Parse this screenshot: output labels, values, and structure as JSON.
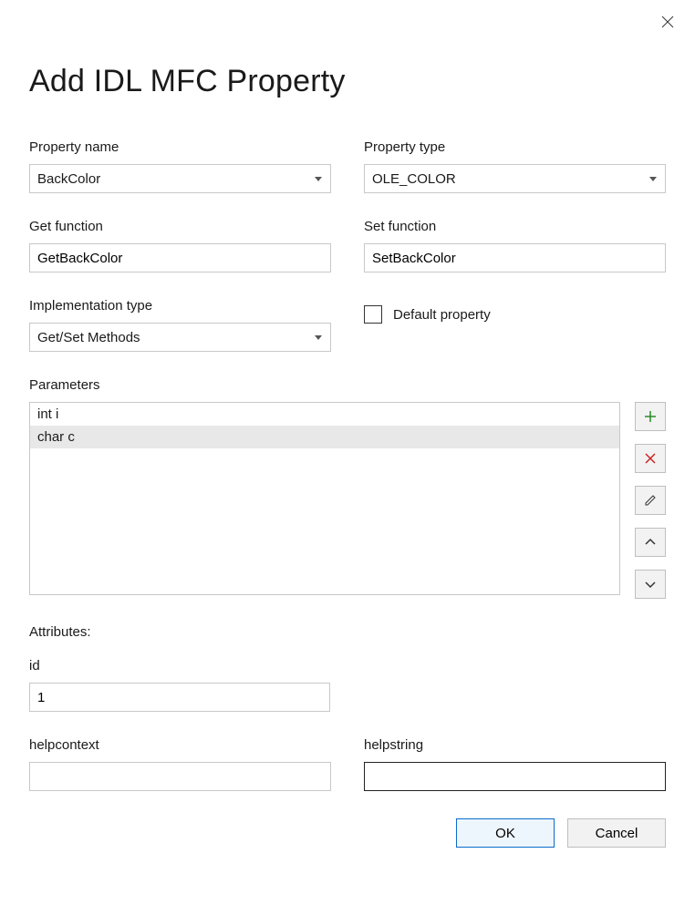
{
  "dialog": {
    "title": "Add IDL MFC Property"
  },
  "fields": {
    "property_name": {
      "label": "Property name",
      "value": "BackColor"
    },
    "property_type": {
      "label": "Property type",
      "value": "OLE_COLOR"
    },
    "get_function": {
      "label": "Get function",
      "value": "GetBackColor"
    },
    "set_function": {
      "label": "Set function",
      "value": "SetBackColor"
    },
    "implementation_type": {
      "label": "Implementation type",
      "value": "Get/Set Methods"
    },
    "default_property": {
      "label": "Default property",
      "checked": false
    },
    "parameters": {
      "label": "Parameters",
      "items": [
        "int i",
        "char c"
      ],
      "selected_index": 1
    },
    "attributes_label": "Attributes:",
    "id": {
      "label": "id",
      "value": "1"
    },
    "helpcontext": {
      "label": "helpcontext",
      "value": ""
    },
    "helpstring": {
      "label": "helpstring",
      "value": ""
    }
  },
  "buttons": {
    "ok": "OK",
    "cancel": "Cancel"
  }
}
